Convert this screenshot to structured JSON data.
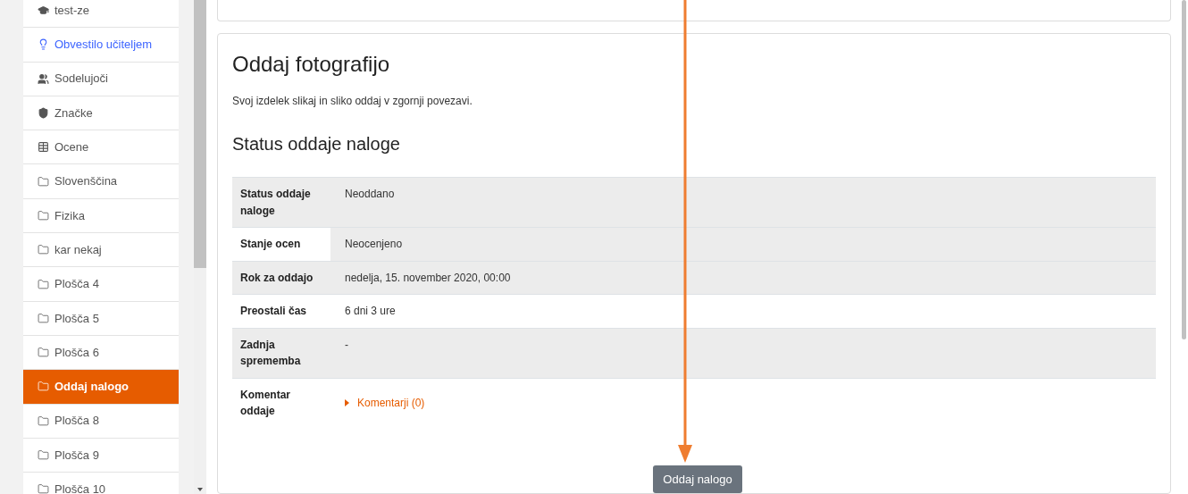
{
  "sidebar": {
    "items": [
      {
        "label": "test-ze",
        "kind": "course",
        "selected": false
      },
      {
        "label": "Obvestilo učiteljem",
        "kind": "notice",
        "selected": false
      },
      {
        "label": "Sodelujoči",
        "kind": "people",
        "selected": false
      },
      {
        "label": "Značke",
        "kind": "badges",
        "selected": false
      },
      {
        "label": "Ocene",
        "kind": "grades",
        "selected": false
      },
      {
        "label": "Slovenščina",
        "kind": "section",
        "selected": false
      },
      {
        "label": "Fizika",
        "kind": "section",
        "selected": false
      },
      {
        "label": "kar nekaj",
        "kind": "section",
        "selected": false
      },
      {
        "label": "Plošča 4",
        "kind": "section",
        "selected": false
      },
      {
        "label": "Plošča 5",
        "kind": "section",
        "selected": false
      },
      {
        "label": "Plošča 6",
        "kind": "section",
        "selected": false
      },
      {
        "label": "Oddaj nalogo",
        "kind": "section",
        "selected": true
      },
      {
        "label": "Plošča 8",
        "kind": "section",
        "selected": false
      },
      {
        "label": "Plošča 9",
        "kind": "section",
        "selected": false
      },
      {
        "label": "Plošča 10",
        "kind": "section",
        "selected": false
      }
    ]
  },
  "assignment": {
    "title": "Oddaj fotografijo",
    "description": "Svoj izdelek slikaj in sliko oddaj v zgornji povezavi.",
    "status_heading": "Status oddaje naloge",
    "rows": [
      {
        "label": "Status oddaje naloge",
        "value": "Neoddano",
        "shaded": true,
        "value_shaded": true,
        "kind": "text"
      },
      {
        "label": "Stanje ocen",
        "value": "Neocenjeno",
        "shaded": false,
        "value_shaded": true,
        "kind": "text"
      },
      {
        "label": "Rok za oddajo",
        "value": "nedelja, 15. november 2020, 00:00",
        "shaded": true,
        "value_shaded": true,
        "kind": "text"
      },
      {
        "label": "Preostali čas",
        "value": "6 dni 3 ure",
        "shaded": false,
        "value_shaded": false,
        "kind": "text"
      },
      {
        "label": "Zadnja sprememba",
        "value": "-",
        "shaded": true,
        "value_shaded": true,
        "kind": "text"
      },
      {
        "label": "Komentar oddaje",
        "value": "Komentarji (0)",
        "shaded": false,
        "value_shaded": false,
        "kind": "comments"
      }
    ],
    "submit_button": "Oddaj nalogo"
  }
}
